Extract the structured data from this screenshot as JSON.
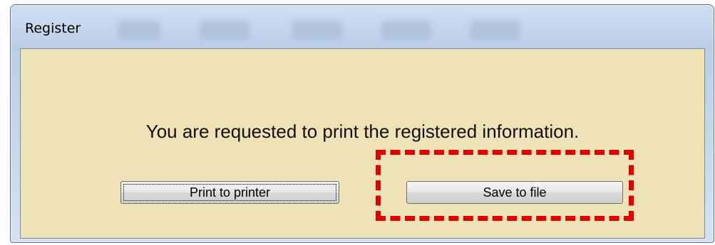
{
  "window": {
    "title": "Register"
  },
  "dialog": {
    "message": "You are requested to print the registered information.",
    "print_button_label": "Print to printer",
    "save_button_label": "Save to file"
  },
  "colors": {
    "dialog_background": "#efe2b6",
    "highlight": "#e00000"
  }
}
